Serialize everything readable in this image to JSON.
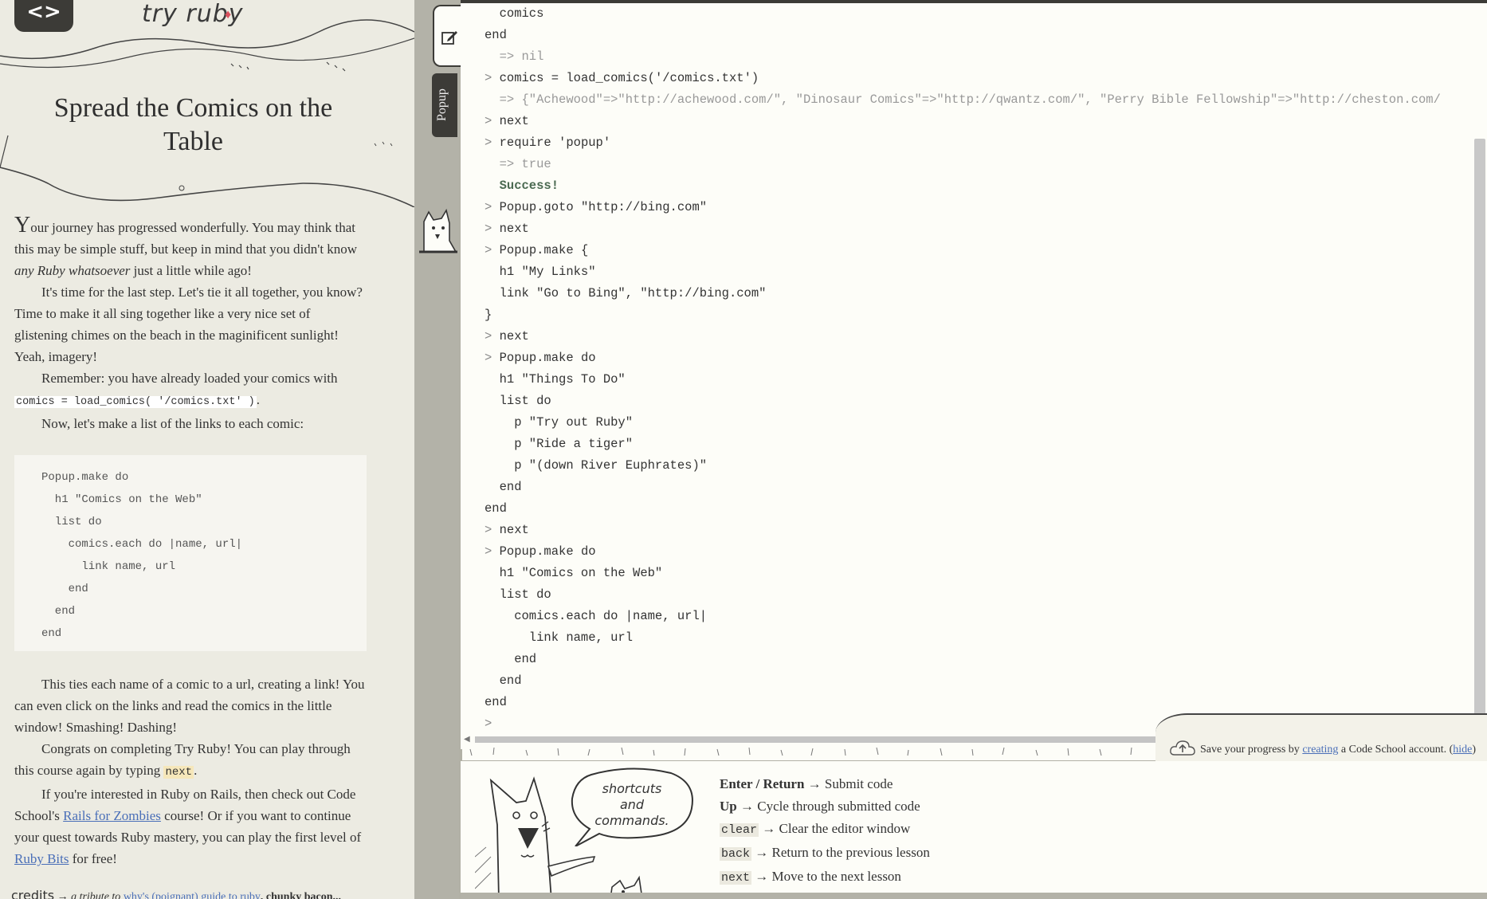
{
  "header": {
    "home_icon": "code-brackets-icon",
    "logo_text": "try ruby",
    "logo_gem": "ruby-gem-icon"
  },
  "lesson": {
    "title_line1": "Spread the Comics on the",
    "title_line2": "Table",
    "p1_dropcap": "Y",
    "p1_a": "our journey has progressed wonderfully. You may think that this may be simple stuff, but keep in mind that you didn't know ",
    "p1_em": "any Ruby whatsoever",
    "p1_b": " just a little while ago!",
    "p2": "It's time for the last step. Let's tie it all together, you know? Time to make it all sing together like a very nice set of glistening chimes on the beach in the maginificent sunlight! Yeah, imagery!",
    "p3_a": "Remember: you have already loaded your comics with",
    "p3_code": "comics = load_comics( '/comics.txt' )",
    "p3_b": ".",
    "p4": "Now, let's make a list of the links to each comic:",
    "code_lines": [
      "Popup.make do",
      "  h1 \"Comics on the Web\"",
      "  list do",
      "    comics.each do |name, url|",
      "      link name, url",
      "    end",
      "  end",
      "end"
    ],
    "p5": "This ties each name of a comic to a url, creating a link! You can even click on the links and read the comics in the little window! Smashing! Dashing!",
    "p6_a": "Congrats on completing Try Ruby! You can play through this course again by typing ",
    "p6_code": "next",
    "p6_b": ".",
    "p7_a": "If you're interested in Ruby on Rails, then check out Code School's ",
    "p7_link1": "Rails for Zombies",
    "p7_b": " course! Or if you want to continue your quest towards Ruby mastery, you can play the first level of ",
    "p7_link2": "Ruby Bits",
    "p7_c": " for free!",
    "credits_label": "credits",
    "credits_arrow": "→",
    "credits_text_a": "a tribute to ",
    "credits_link": "why's (poignant) guide to ruby",
    "credits_text_b": ", chunky bacon..."
  },
  "side_tabs": {
    "popup_label": "Popup",
    "edit_icon": "edit-pencil-icon"
  },
  "console": {
    "lines": [
      {
        "type": "code",
        "text": "  comics"
      },
      {
        "type": "code",
        "text": "end"
      },
      {
        "type": "result",
        "text": "  => nil"
      },
      {
        "type": "input",
        "text": "comics = load_comics('/comics.txt')"
      },
      {
        "type": "result",
        "text": "  => {\"Achewood\"=>\"http://achewood.com/\", \"Dinosaur Comics\"=>\"http://qwantz.com/\", \"Perry Bible Fellowship\"=>\"http://cheston.com/"
      },
      {
        "type": "input",
        "text": "next"
      },
      {
        "type": "input",
        "text": "require 'popup'"
      },
      {
        "type": "result",
        "text": "  => true"
      },
      {
        "type": "success",
        "text": "  Success!"
      },
      {
        "type": "input",
        "text": "Popup.goto \"http://bing.com\""
      },
      {
        "type": "input",
        "text": "next"
      },
      {
        "type": "input",
        "text": "Popup.make {"
      },
      {
        "type": "code",
        "text": "  h1 \"My Links\""
      },
      {
        "type": "code",
        "text": "  link \"Go to Bing\", \"http://bing.com\""
      },
      {
        "type": "code",
        "text": "}"
      },
      {
        "type": "input",
        "text": "next"
      },
      {
        "type": "input",
        "text": "Popup.make do"
      },
      {
        "type": "code",
        "text": "  h1 \"Things To Do\""
      },
      {
        "type": "code",
        "text": "  list do"
      },
      {
        "type": "code",
        "text": "    p \"Try out Ruby\""
      },
      {
        "type": "code",
        "text": "    p \"Ride a tiger\""
      },
      {
        "type": "code",
        "text": "    p \"(down River Euphrates)\""
      },
      {
        "type": "code",
        "text": "  end"
      },
      {
        "type": "code",
        "text": "end"
      },
      {
        "type": "input",
        "text": "next"
      },
      {
        "type": "input",
        "text": "Popup.make do"
      },
      {
        "type": "code",
        "text": "  h1 \"Comics on the Web\""
      },
      {
        "type": "code",
        "text": "  list do"
      },
      {
        "type": "code",
        "text": "    comics.each do |name, url|"
      },
      {
        "type": "code",
        "text": "      link name, url"
      },
      {
        "type": "code",
        "text": "    end"
      },
      {
        "type": "code",
        "text": "  end"
      },
      {
        "type": "code",
        "text": "end"
      },
      {
        "type": "input",
        "text": ""
      }
    ],
    "prompt_char": ">"
  },
  "save_banner": {
    "icon": "cloud-upload-icon",
    "text_a": "Save your progress by ",
    "link_create": "creating",
    "text_b": " a Code School account. (",
    "link_hide": "hide",
    "text_c": ")"
  },
  "shortcuts": {
    "bubble_line1": "shortcuts",
    "bubble_line2": "and",
    "bubble_line3": "commands.",
    "items": [
      {
        "key": "Enter / Return",
        "arrow": "→",
        "desc": "Submit code"
      },
      {
        "key": "Up",
        "arrow": "→",
        "desc": "Cycle through submitted code"
      },
      {
        "code": "clear",
        "arrow": "→",
        "desc": "Clear the editor window"
      },
      {
        "code": "back",
        "arrow": "→",
        "desc": "Return to the previous lesson"
      },
      {
        "code": "next",
        "arrow": "→",
        "desc": "Move to the next lesson"
      }
    ]
  },
  "colors": {
    "lesson_bg": "#ecebe2",
    "console_bg": "#fdfdf8",
    "dark_tab": "#3c3b37",
    "link": "#4a6fb8",
    "ruby_gem": "#d9505d"
  }
}
